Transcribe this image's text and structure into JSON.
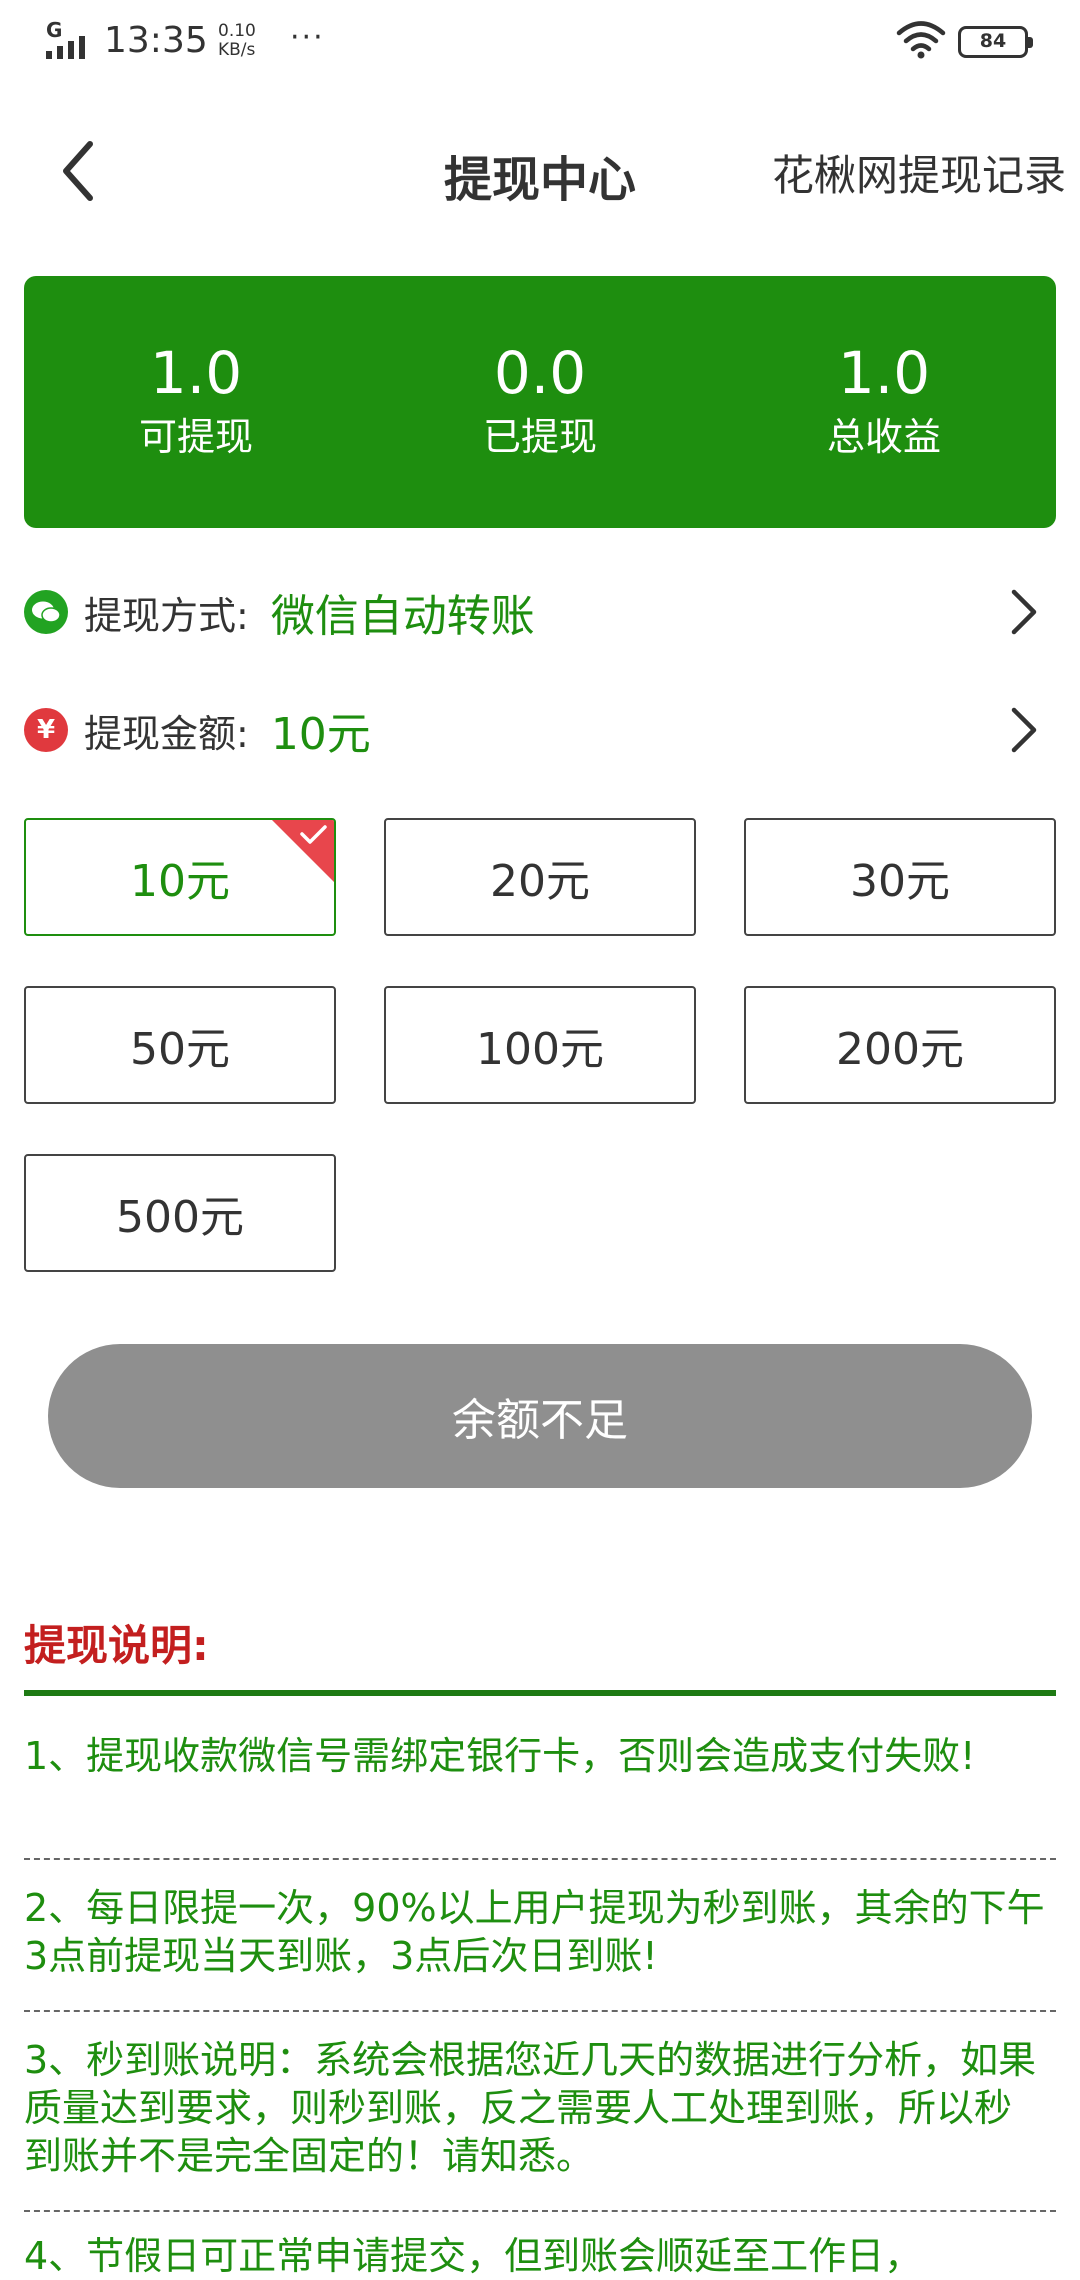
{
  "status_bar": {
    "network": "G",
    "time": "13:35",
    "speed_value": "0.10",
    "speed_unit": "KB/s",
    "more": "···",
    "battery": "84"
  },
  "header": {
    "title": "提现中心",
    "record_link": "花楸网提现记录",
    "back_icon": "chevron-left-icon"
  },
  "stats": [
    {
      "value": "1.0",
      "label": "可提现"
    },
    {
      "value": "0.0",
      "label": "已提现"
    },
    {
      "value": "1.0",
      "label": "总收益"
    }
  ],
  "method_row": {
    "icon": "wechat-icon",
    "label": "提现方式:",
    "value": "微信自动转账"
  },
  "amount_row": {
    "icon": "yuan-icon",
    "label": "提现金额:",
    "value": "10元"
  },
  "amount_options": [
    "10元",
    "20元",
    "30元",
    "50元",
    "100元",
    "200元",
    "500元"
  ],
  "selected_amount_index": 0,
  "submit_label": "余额不足",
  "notes": {
    "title": "提现说明:",
    "items": [
      "1、提现收款微信号需绑定银行卡，否则会造成支付失败!",
      "2、每日限提一次，90%以上用户提现为秒到账，其余的下午3点前提现当天到账，3点后次日到账!",
      "3、秒到账说明：系统会根据您近几天的数据进行分析，如果质量达到要求，则秒到账，反之需要人工处理到账，所以秒到账并不是完全固定的！请知悉。",
      "4、节假日可正常申请提交，但到账会顺延至工作日，"
    ]
  },
  "colors": {
    "brand_green": "#1e8e0f",
    "notes_title_red": "#c31f1f",
    "badge_red": "#e8464c",
    "disabled_button": "#8f8f8f"
  }
}
